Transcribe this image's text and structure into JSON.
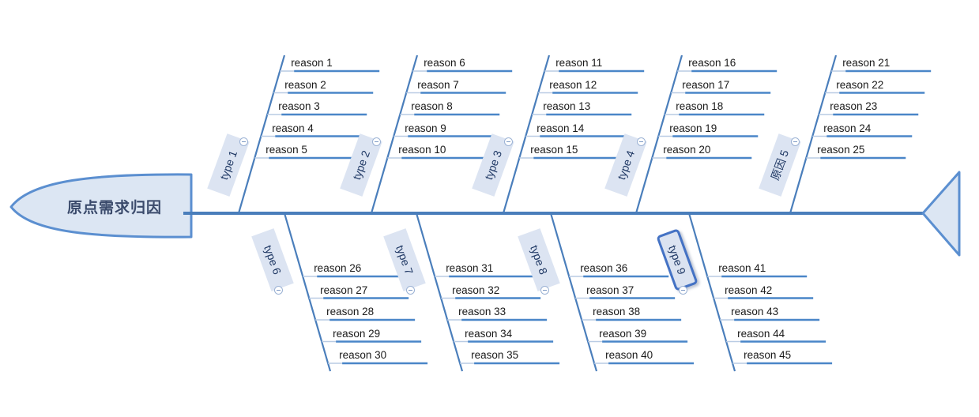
{
  "diagram": {
    "type": "fishbone",
    "title": "原点需求归因",
    "background_color": "#ffffff",
    "spine_color": "#4a7ebb",
    "branch_color": "#4a7ebb",
    "label_fill": "#dce4f2",
    "label_text_color": "#1f3864",
    "head_fill": "#dce6f3",
    "head_stroke": "#5b8fd0",
    "selected_stroke": "#4472c4",
    "underline_color": "#4a86c8",
    "connector_color": "#b9cbe4"
  },
  "head": {
    "label": "原点需求归因",
    "name": "fishbone-head"
  },
  "tail": {
    "name": "fishbone-tail"
  },
  "toggle": {
    "icon": "minus-circle-icon",
    "state": "expanded"
  },
  "branches_top": [
    {
      "label": "type 1",
      "selected": false,
      "reasons": [
        "reason 1",
        "reason 2",
        "reason 3",
        "reason 4",
        "reason 5"
      ]
    },
    {
      "label": "type 2",
      "selected": false,
      "reasons": [
        "reason 6",
        "reason 7",
        "reason 8",
        "reason 9",
        "reason 10"
      ]
    },
    {
      "label": "type 3",
      "selected": false,
      "reasons": [
        "reason 11",
        "reason 12",
        "reason 13",
        "reason 14",
        "reason 15"
      ]
    },
    {
      "label": "type 4",
      "selected": false,
      "reasons": [
        "reason 16",
        "reason 17",
        "reason 18",
        "reason 19",
        "reason 20"
      ]
    },
    {
      "label": "原因 5",
      "selected": false,
      "reasons": [
        "reason 21",
        "reason 22",
        "reason 23",
        "reason 24",
        "reason 25"
      ]
    }
  ],
  "branches_bottom": [
    {
      "label": "type 6",
      "selected": false,
      "reasons": [
        "reason 26",
        "reason 27",
        "reason 28",
        "reason 29",
        "reason 30"
      ]
    },
    {
      "label": "type 7",
      "selected": false,
      "reasons": [
        "reason 31",
        "reason 32",
        "reason 33",
        "reason 34",
        "reason 35"
      ]
    },
    {
      "label": "type 8",
      "selected": false,
      "reasons": [
        "reason 36",
        "reason 37",
        "reason 38",
        "reason 39",
        "reason 40"
      ]
    },
    {
      "label": "type 9",
      "selected": true,
      "reasons": [
        "reason 41",
        "reason 42",
        "reason 43",
        "reason 44",
        "reason 45"
      ]
    }
  ]
}
